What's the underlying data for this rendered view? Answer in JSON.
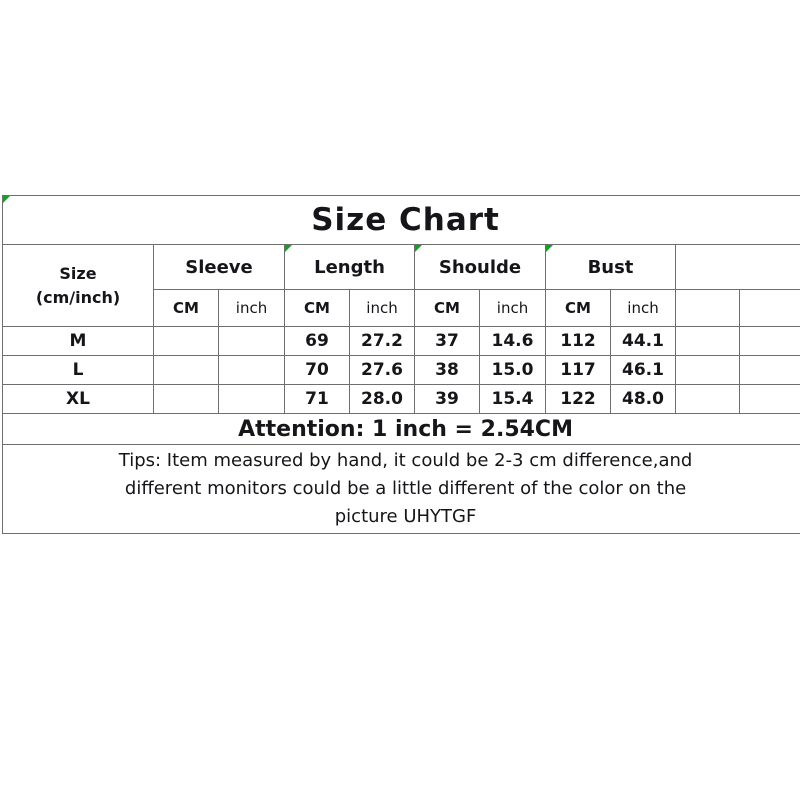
{
  "chart_data": {
    "type": "table",
    "title": "Size Chart",
    "row_header_label": {
      "line1": "Size",
      "line2": "(cm/inch)"
    },
    "measurements": [
      "Sleeve",
      "Length",
      "Shoulde",
      "Bust"
    ],
    "units": [
      "CM",
      "inch"
    ],
    "columns": [
      "Size (cm/inch)",
      "Sleeve CM",
      "Sleeve inch",
      "Length CM",
      "Length inch",
      "Shoulde CM",
      "Shoulde inch",
      "Bust CM",
      "Bust inch"
    ],
    "sizes": [
      "M",
      "L",
      "XL"
    ],
    "rows": [
      {
        "size": "M",
        "sleeve_cm": "",
        "sleeve_inch": "",
        "length_cm": "69",
        "length_inch": "27.2",
        "shoulde_cm": "37",
        "shoulde_inch": "14.6",
        "bust_cm": "112",
        "bust_inch": "44.1"
      },
      {
        "size": "L",
        "sleeve_cm": "",
        "sleeve_inch": "",
        "length_cm": "70",
        "length_inch": "27.6",
        "shoulde_cm": "38",
        "shoulde_inch": "15.0",
        "bust_cm": "117",
        "bust_inch": "46.1"
      },
      {
        "size": "XL",
        "sleeve_cm": "",
        "sleeve_inch": "",
        "length_cm": "71",
        "length_inch": "28.0",
        "shoulde_cm": "39",
        "shoulde_inch": "15.4",
        "bust_cm": "122",
        "bust_inch": "48.0"
      }
    ],
    "attention": "Attention: 1 inch = 2.54CM",
    "tips_lines": [
      "Tips: Item measured by hand, it could be 2-3 cm difference,and",
      "different monitors could be a little different of the color on the",
      "picture UHYTGF"
    ],
    "colors": {
      "unit_header": "#e81111",
      "attention": "#ff0d0d",
      "text": "#16161a",
      "grid": "#6f6f6f",
      "background": "#ffffff",
      "comment_marker": "#14a024"
    }
  }
}
